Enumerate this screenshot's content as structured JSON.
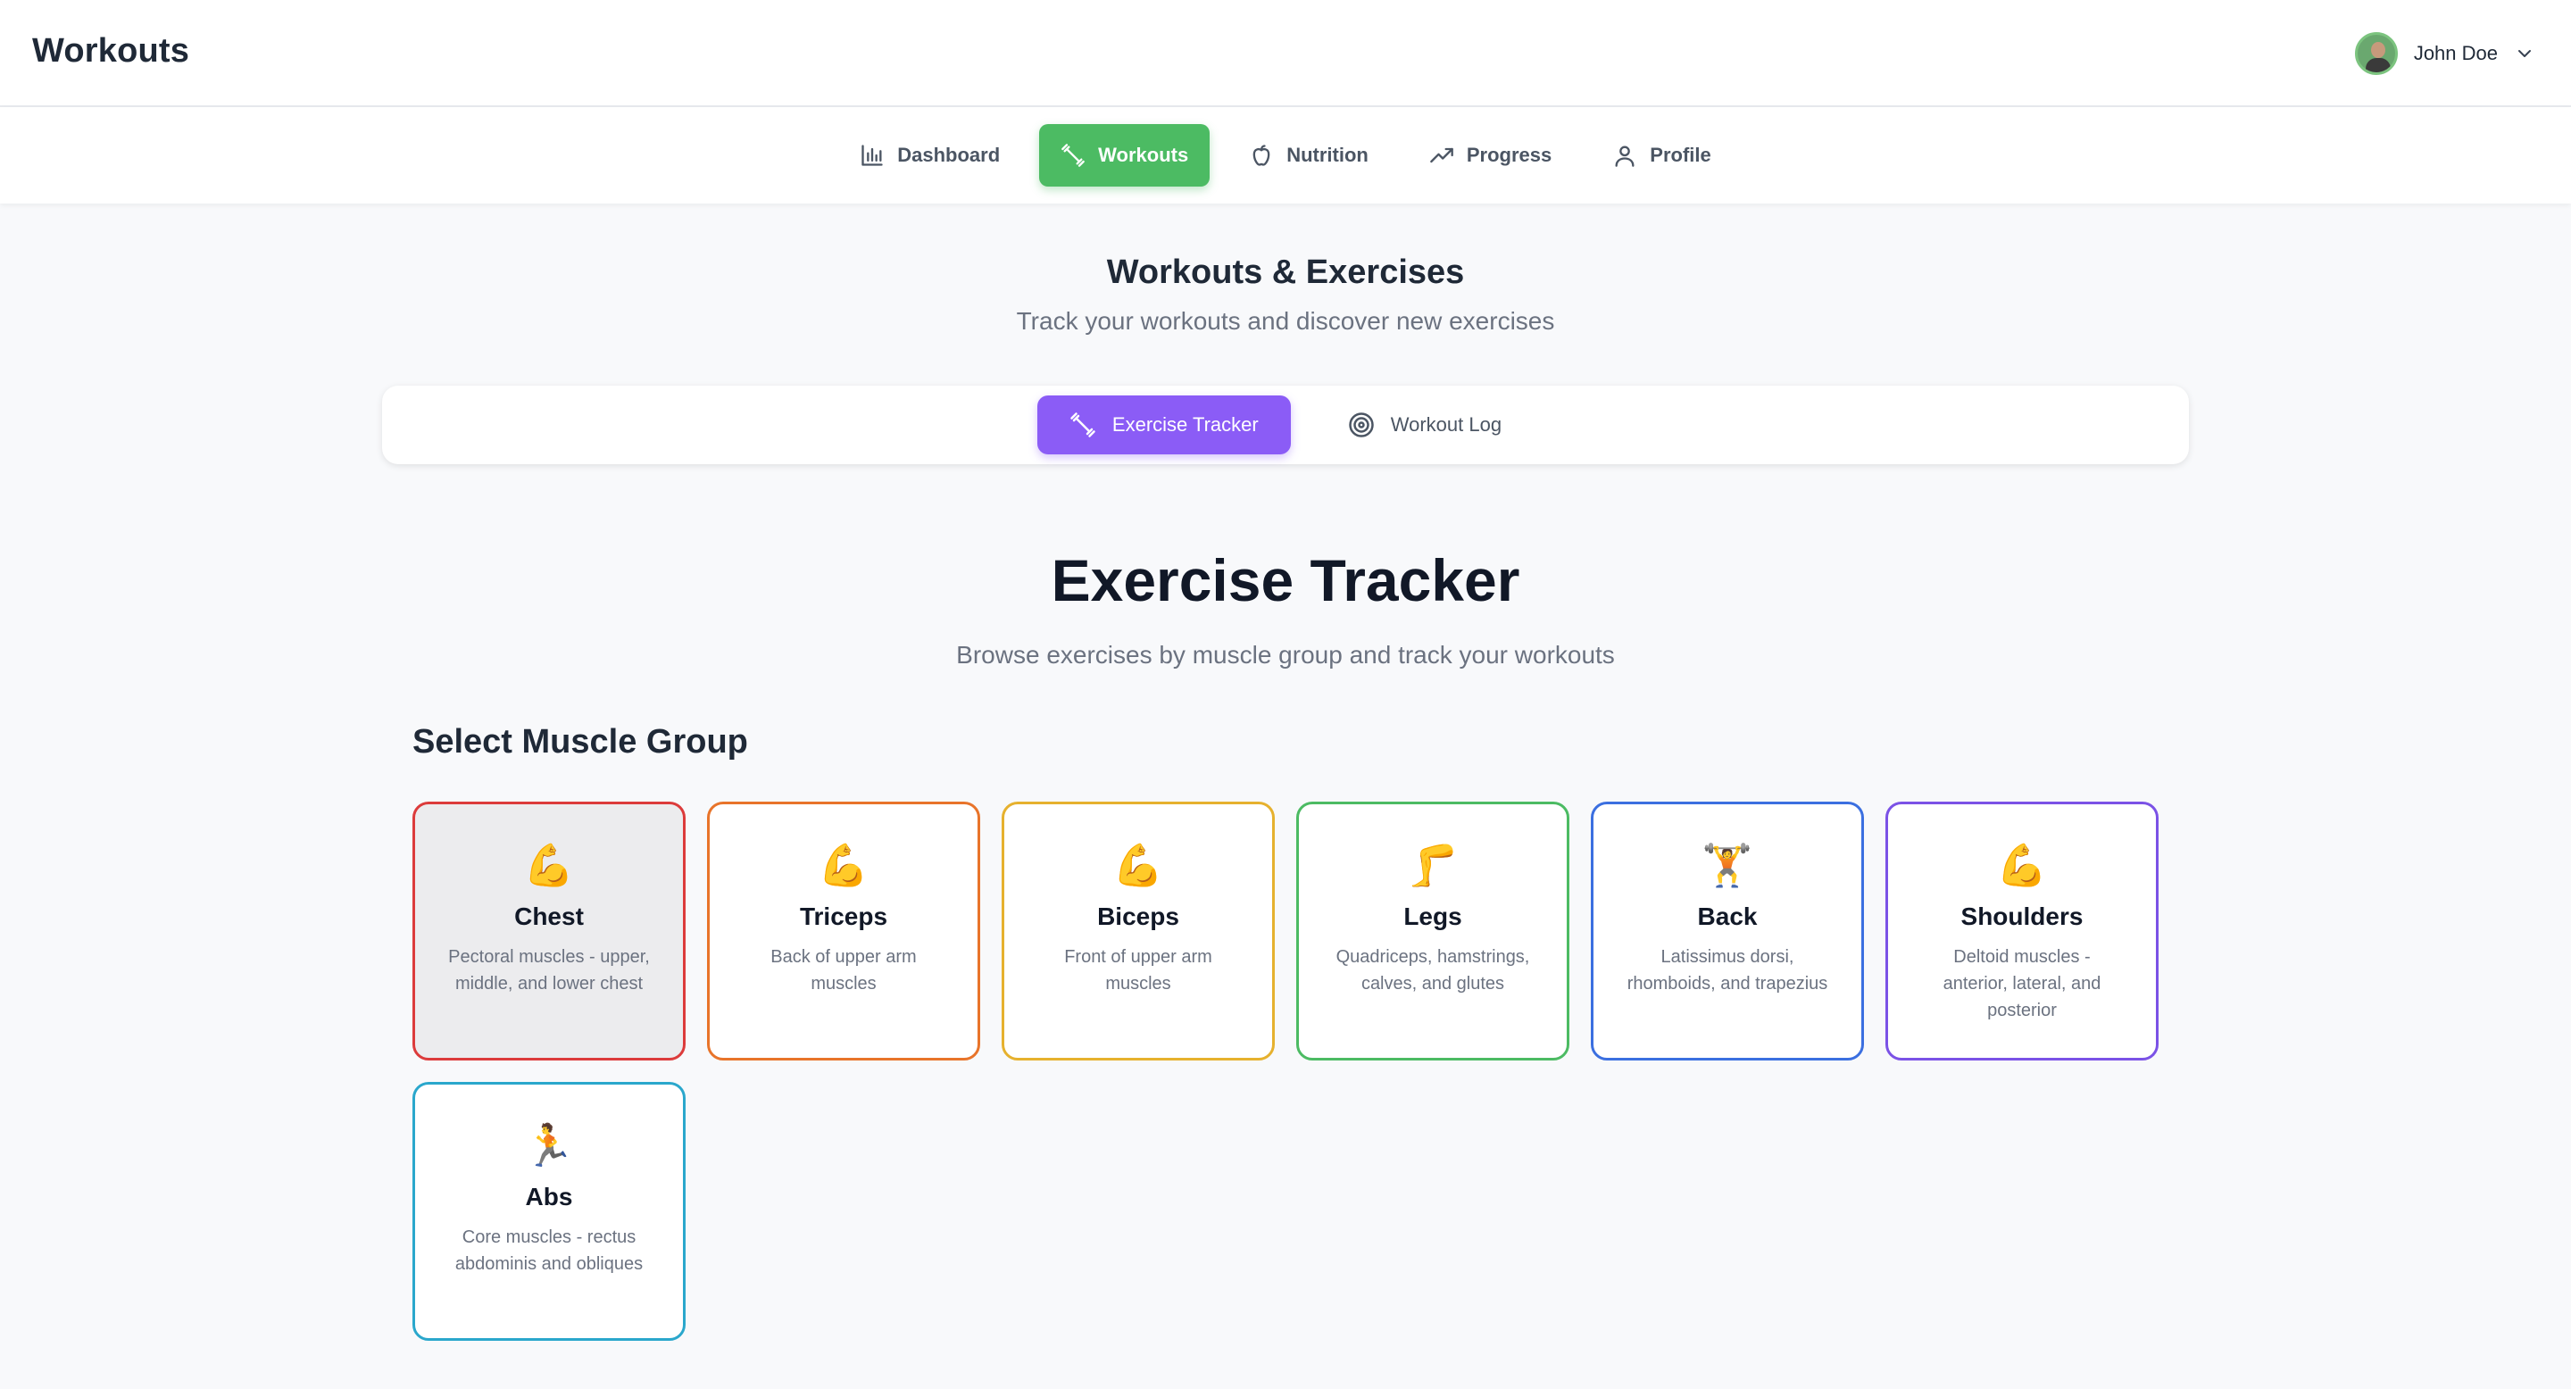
{
  "app": {
    "title": "Workouts"
  },
  "user": {
    "name": "John Doe"
  },
  "nav": {
    "items": [
      {
        "label": "Dashboard",
        "icon": "bar-chart-icon",
        "active": false
      },
      {
        "label": "Workouts",
        "icon": "dumbbell-icon",
        "active": true
      },
      {
        "label": "Nutrition",
        "icon": "apple-icon",
        "active": false
      },
      {
        "label": "Progress",
        "icon": "trending-up-icon",
        "active": false
      },
      {
        "label": "Profile",
        "icon": "user-icon",
        "active": false
      }
    ]
  },
  "page": {
    "title": "Workouts & Exercises",
    "subtitle": "Track your workouts and discover new exercises"
  },
  "subtabs": [
    {
      "label": "Exercise Tracker",
      "icon": "dumbbell-icon",
      "active": true
    },
    {
      "label": "Workout Log",
      "icon": "target-icon",
      "active": false
    }
  ],
  "tracker": {
    "title": "Exercise Tracker",
    "subtitle": "Browse exercises by muscle group and track your workouts",
    "section_title": "Select Muscle Group",
    "muscle_groups": [
      {
        "emoji": "💪",
        "name": "Chest",
        "desc": "Pectoral muscles - upper, middle, and lower chest",
        "color": "#dc3b3b",
        "selected": true
      },
      {
        "emoji": "💪",
        "name": "Triceps",
        "desc": "Back of upper arm muscles",
        "color": "#e8742a",
        "selected": false
      },
      {
        "emoji": "💪",
        "name": "Biceps",
        "desc": "Front of upper arm muscles",
        "color": "#e6b12e",
        "selected": false
      },
      {
        "emoji": "🦵",
        "name": "Legs",
        "desc": "Quadriceps, hamstrings, calves, and glutes",
        "color": "#4cbb63",
        "selected": false
      },
      {
        "emoji": "🏋️",
        "name": "Back",
        "desc": "Latissimus dorsi, rhomboids, and trapezius",
        "color": "#3b6fe0",
        "selected": false
      },
      {
        "emoji": "💪",
        "name": "Shoulders",
        "desc": "Deltoid muscles - anterior, lateral, and posterior",
        "color": "#7b52e6",
        "selected": false
      },
      {
        "emoji": "🏃",
        "name": "Abs",
        "desc": "Core muscles - rectus abdominis and obliques",
        "color": "#2aa7cc",
        "selected": false
      }
    ]
  }
}
